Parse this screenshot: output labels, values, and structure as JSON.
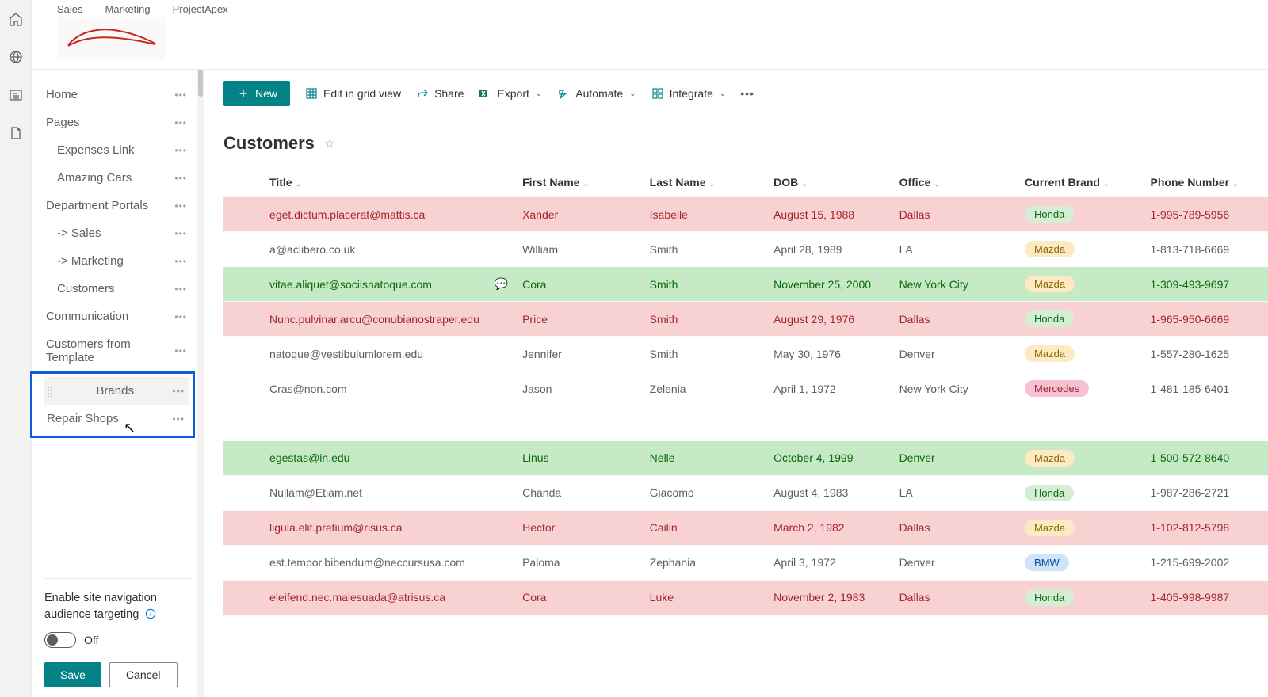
{
  "tabs": [
    "Sales",
    "Marketing",
    "ProjectApex"
  ],
  "sidebar": {
    "items": [
      {
        "label": "Home"
      },
      {
        "label": "Pages"
      },
      {
        "label": "Expenses Link",
        "sub": true
      },
      {
        "label": "Amazing Cars",
        "sub": true
      },
      {
        "label": "Department Portals"
      },
      {
        "label": "-> Sales",
        "sub": true
      },
      {
        "label": "-> Marketing",
        "sub": true
      },
      {
        "label": "Customers",
        "sub": true
      },
      {
        "label": "Communication"
      },
      {
        "label": "Customers from Template"
      }
    ],
    "boxed": [
      {
        "label": "Brands"
      },
      {
        "label": "Repair Shops"
      }
    ]
  },
  "navfoot": {
    "text": "Enable site navigation audience targeting",
    "toggle": "Off",
    "save": "Save",
    "cancel": "Cancel"
  },
  "cmdbar": {
    "new": "New",
    "edit": "Edit in grid view",
    "share": "Share",
    "export": "Export",
    "automate": "Automate",
    "integrate": "Integrate"
  },
  "list": {
    "title": "Customers"
  },
  "columns": {
    "title": "Title",
    "first": "First Name",
    "last": "Last Name",
    "dob": "DOB",
    "office": "Office",
    "brand": "Current Brand",
    "phone": "Phone Number"
  },
  "rows": [
    {
      "title": "eget.dictum.placerat@mattis.ca",
      "first": "Xander",
      "last": "Isabelle",
      "dob": "August 15, 1988",
      "office": "Dallas",
      "brand": "Honda",
      "brandCls": "honda",
      "phone": "1-995-789-5956",
      "cls": "r-pink"
    },
    {
      "title": "a@aclibero.co.uk",
      "first": "William",
      "last": "Smith",
      "dob": "April 28, 1989",
      "office": "LA",
      "brand": "Mazda",
      "brandCls": "mazda",
      "phone": "1-813-718-6669",
      "cls": ""
    },
    {
      "title": "vitae.aliquet@sociisnatoque.com",
      "first": "Cora",
      "last": "Smith",
      "dob": "November 25, 2000",
      "office": "New York City",
      "brand": "Mazda",
      "brandCls": "mazda",
      "phone": "1-309-493-9697",
      "cls": "r-green",
      "comment": true
    },
    {
      "title": "Nunc.pulvinar.arcu@conubianostraper.edu",
      "first": "Price",
      "last": "Smith",
      "dob": "August 29, 1976",
      "office": "Dallas",
      "brand": "Honda",
      "brandCls": "honda",
      "phone": "1-965-950-6669",
      "cls": "r-pink"
    },
    {
      "title": "natoque@vestibulumlorem.edu",
      "first": "Jennifer",
      "last": "Smith",
      "dob": "May 30, 1976",
      "office": "Denver",
      "brand": "Mazda",
      "brandCls": "mazda",
      "phone": "1-557-280-1625",
      "cls": ""
    },
    {
      "title": "Cras@non.com",
      "first": "Jason",
      "last": "Zelenia",
      "dob": "April 1, 1972",
      "office": "New York City",
      "brand": "Mercedes",
      "brandCls": "mercedes",
      "phone": "1-481-185-6401",
      "cls": ""
    },
    {
      "spacer": true
    },
    {
      "title": "egestas@in.edu",
      "first": "Linus",
      "last": "Nelle",
      "dob": "October 4, 1999",
      "office": "Denver",
      "brand": "Mazda",
      "brandCls": "mazda",
      "phone": "1-500-572-8640",
      "cls": "r-green"
    },
    {
      "title": "Nullam@Etiam.net",
      "first": "Chanda",
      "last": "Giacomo",
      "dob": "August 4, 1983",
      "office": "LA",
      "brand": "Honda",
      "brandCls": "honda",
      "phone": "1-987-286-2721",
      "cls": ""
    },
    {
      "title": "ligula.elit.pretium@risus.ca",
      "first": "Hector",
      "last": "Cailin",
      "dob": "March 2, 1982",
      "office": "Dallas",
      "brand": "Mazda",
      "brandCls": "mazda",
      "phone": "1-102-812-5798",
      "cls": "r-pink"
    },
    {
      "title": "est.tempor.bibendum@neccursusa.com",
      "first": "Paloma",
      "last": "Zephania",
      "dob": "April 3, 1972",
      "office": "Denver",
      "brand": "BMW",
      "brandCls": "bmw",
      "phone": "1-215-699-2002",
      "cls": ""
    },
    {
      "title": "eleifend.nec.malesuada@atrisus.ca",
      "first": "Cora",
      "last": "Luke",
      "dob": "November 2, 1983",
      "office": "Dallas",
      "brand": "Honda",
      "brandCls": "honda",
      "phone": "1-405-998-9987",
      "cls": "r-pink"
    }
  ]
}
